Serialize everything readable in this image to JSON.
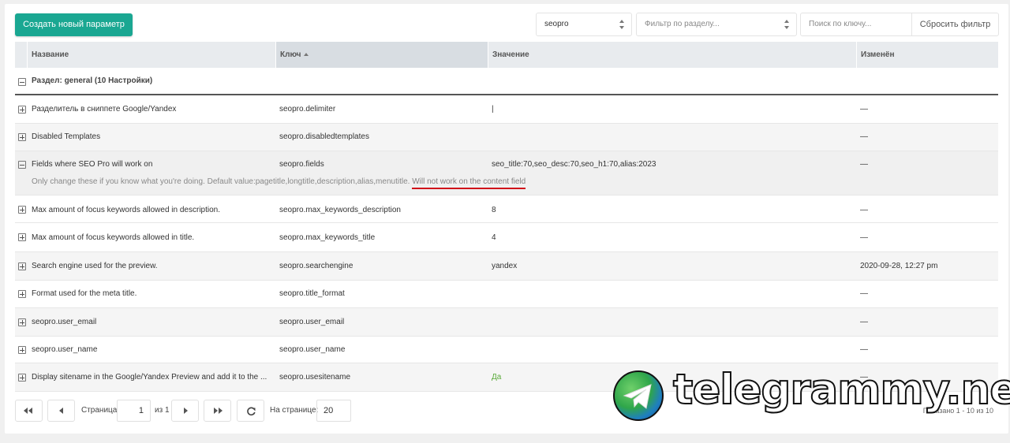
{
  "toolbar": {
    "create_button": "Создать новый параметр",
    "namespace_value": "seopro",
    "area_placeholder": "Фильтр по разделу...",
    "search_placeholder": "Поиск по ключу...",
    "reset_button": "Сбросить фильтр"
  },
  "columns": {
    "name": "Название",
    "key": "Ключ",
    "value": "Значение",
    "modified": "Изменён"
  },
  "group": {
    "label": "Раздел: general (10 Настройки)"
  },
  "rows": [
    {
      "name": "Разделитель в сниппете Google/Yandex",
      "key": "seopro.delimiter",
      "value": "|",
      "modified": "—"
    },
    {
      "name": "Disabled Templates",
      "key": "seopro.disabledtemplates",
      "value": "",
      "modified": "—"
    },
    {
      "name": "Fields where SEO Pro will work on",
      "key": "seopro.fields",
      "value": "seo_title:70,seo_desc:70,seo_h1:70,alias:2023",
      "modified": "—",
      "description": "Only change these if you know what you're doing. Default value:pagetitle,longtitle,description,alias,menutitle.",
      "description_warning": "Will not work on the content field"
    },
    {
      "name": "Max amount of focus keywords allowed in description.",
      "key": "seopro.max_keywords_description",
      "value": "8",
      "modified": "—"
    },
    {
      "name": "Max amount of focus keywords allowed in title.",
      "key": "seopro.max_keywords_title",
      "value": "4",
      "modified": "—"
    },
    {
      "name": "Search engine used for the preview.",
      "key": "seopro.searchengine",
      "value": "yandex",
      "modified": "2020-09-28, 12:27 pm"
    },
    {
      "name": "Format used for the meta title.",
      "key": "seopro.title_format",
      "value": "",
      "modified": "—"
    },
    {
      "name": "seopro.user_email",
      "key": "seopro.user_email",
      "value": "",
      "modified": "—"
    },
    {
      "name": "seopro.user_name",
      "key": "seopro.user_name",
      "value": "",
      "modified": "—"
    },
    {
      "name": "Display sitename in the Google/Yandex Preview and add it to the ...",
      "key": "seopro.usesitename",
      "value": "Да",
      "modified": "—"
    }
  ],
  "pager": {
    "page_label": "Страница",
    "page_value": "1",
    "of_label": "из 1",
    "per_page_label": "На странице:",
    "per_page_value": "20",
    "shown": "Показано 1 - 10 из 10"
  },
  "watermark": {
    "text": "telegrammy.net"
  },
  "colors": {
    "accent": "#1aa792",
    "underline": "#d0121a",
    "yes": "#5aaa3a"
  }
}
